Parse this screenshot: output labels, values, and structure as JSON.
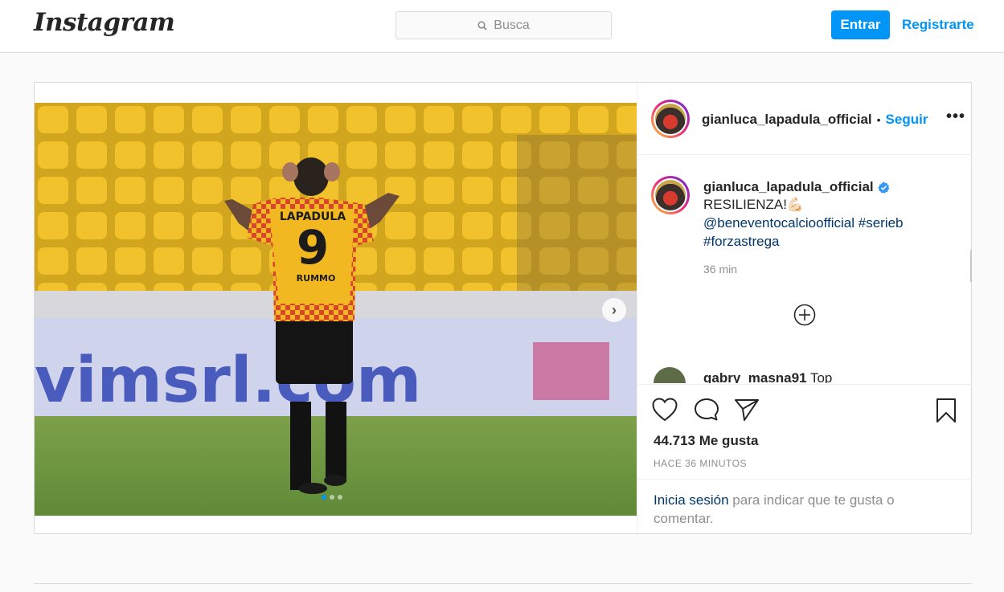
{
  "nav": {
    "logo_text": "Instagram",
    "search_placeholder": "Busca",
    "login_label": "Entrar",
    "register_label": "Registrarte"
  },
  "post": {
    "author": "gianluca_lapadula_official",
    "follow_label": "Seguir",
    "separator": "•",
    "caption": {
      "line1": "RESILIENZA!💪🏻",
      "mention": "@beneventocalcioofficial",
      "tag1": "#serieb",
      "tag2": "#forzastrega",
      "age": "36 min"
    },
    "top_comment": {
      "user": "gabry_masna91",
      "text": "Top"
    },
    "likes": "44.713 Me gusta",
    "posted": "HACE 36 MINUTOS",
    "login_prompt": {
      "link": "Inicia sesión",
      "rest": " para indicar que te gusta o comentar."
    },
    "media": {
      "banner_text": "vimsrl.com",
      "jersey_name": "LAPADULA",
      "jersey_number": "9",
      "sponsor": "RUMMO",
      "slide_count": 3,
      "active_slide": 1
    }
  },
  "colors": {
    "accent": "#0095f6",
    "link": "#00376b",
    "verified": "#3897f0",
    "muted": "#8e8e8e"
  },
  "icons": [
    "search-icon",
    "verified-badge-icon",
    "more-options-icon",
    "heart-icon",
    "comment-icon",
    "share-icon",
    "bookmark-icon",
    "load-more-icon",
    "chevron-right-icon"
  ]
}
